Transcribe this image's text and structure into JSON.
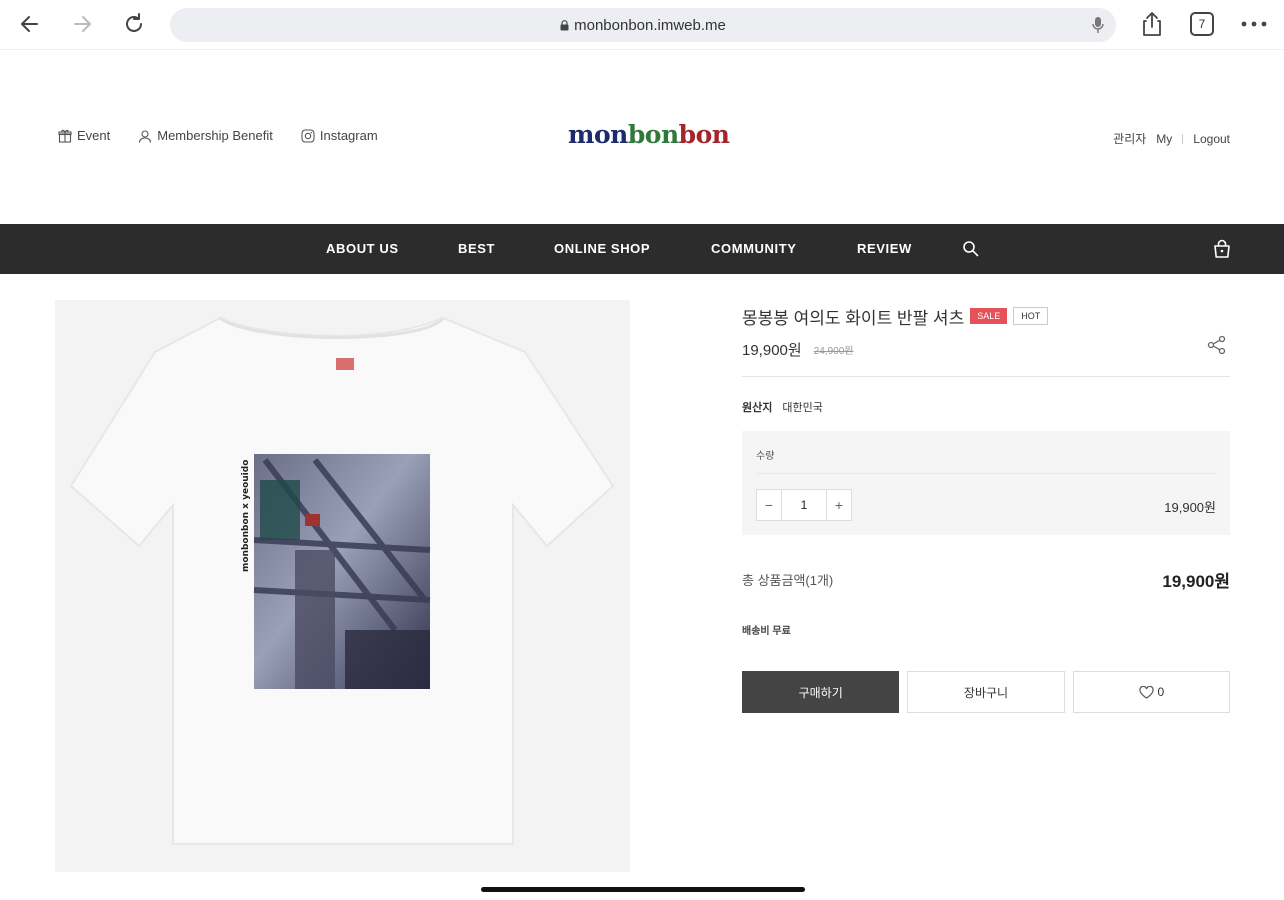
{
  "browser": {
    "url": "monbonbon.imweb.me",
    "tab_count": "7"
  },
  "header": {
    "links": [
      {
        "label": "Event",
        "icon": "gift-icon"
      },
      {
        "label": "Membership Benefit",
        "icon": "user-icon"
      },
      {
        "label": "Instagram",
        "icon": "instagram-icon"
      }
    ],
    "logo": {
      "part1": "mon",
      "part2": "bon",
      "part3": "bon"
    },
    "user_links": {
      "admin": "관리자",
      "my": "My",
      "logout": "Logout"
    }
  },
  "menu": {
    "items": [
      "ABOUT US",
      "BEST",
      "ONLINE SHOP",
      "COMMUNITY",
      "REVIEW"
    ]
  },
  "product": {
    "title": "몽봉봉 여의도 화이트 반팔 셔츠",
    "badge_sale": "SALE",
    "badge_hot": "HOT",
    "price": "19,900원",
    "original_price": "24,900원",
    "origin_label": "원산지",
    "origin_value": "대한민국",
    "quantity_label": "수량",
    "quantity": "1",
    "line_price": "19,900원",
    "total_label": "총 상품금액(1개)",
    "total_price": "19,900원",
    "shipping": "배송비 무료",
    "buy_label": "구매하기",
    "cart_label": "장바구니",
    "wish_count": "0",
    "print_text": "monbonbon x yeouido"
  },
  "colors": {
    "menu_bg": "#2c2c2c",
    "sale_badge": "#e5525a",
    "buy_button": "#444444"
  }
}
